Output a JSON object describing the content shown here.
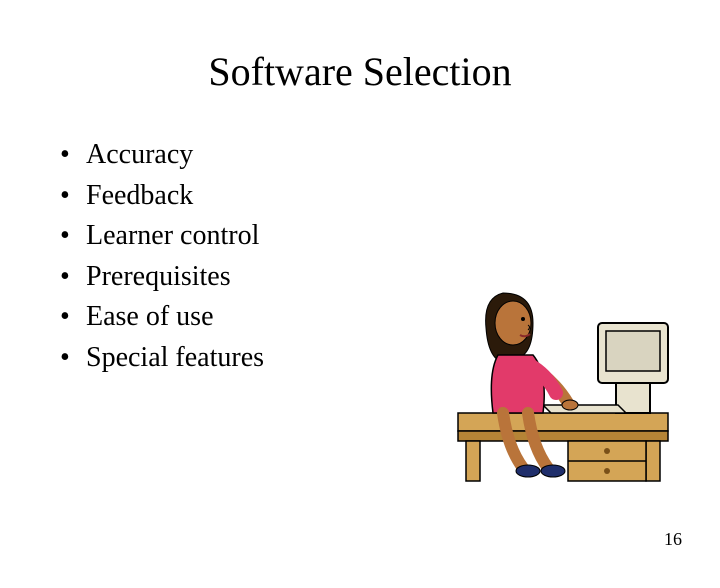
{
  "title": "Software Selection",
  "bullets": [
    "Accuracy",
    "Feedback",
    "Learner control",
    "Prerequisites",
    "Ease of use",
    "Special features"
  ],
  "page_number": "16",
  "illustration": {
    "name": "person-at-computer-clipart"
  }
}
